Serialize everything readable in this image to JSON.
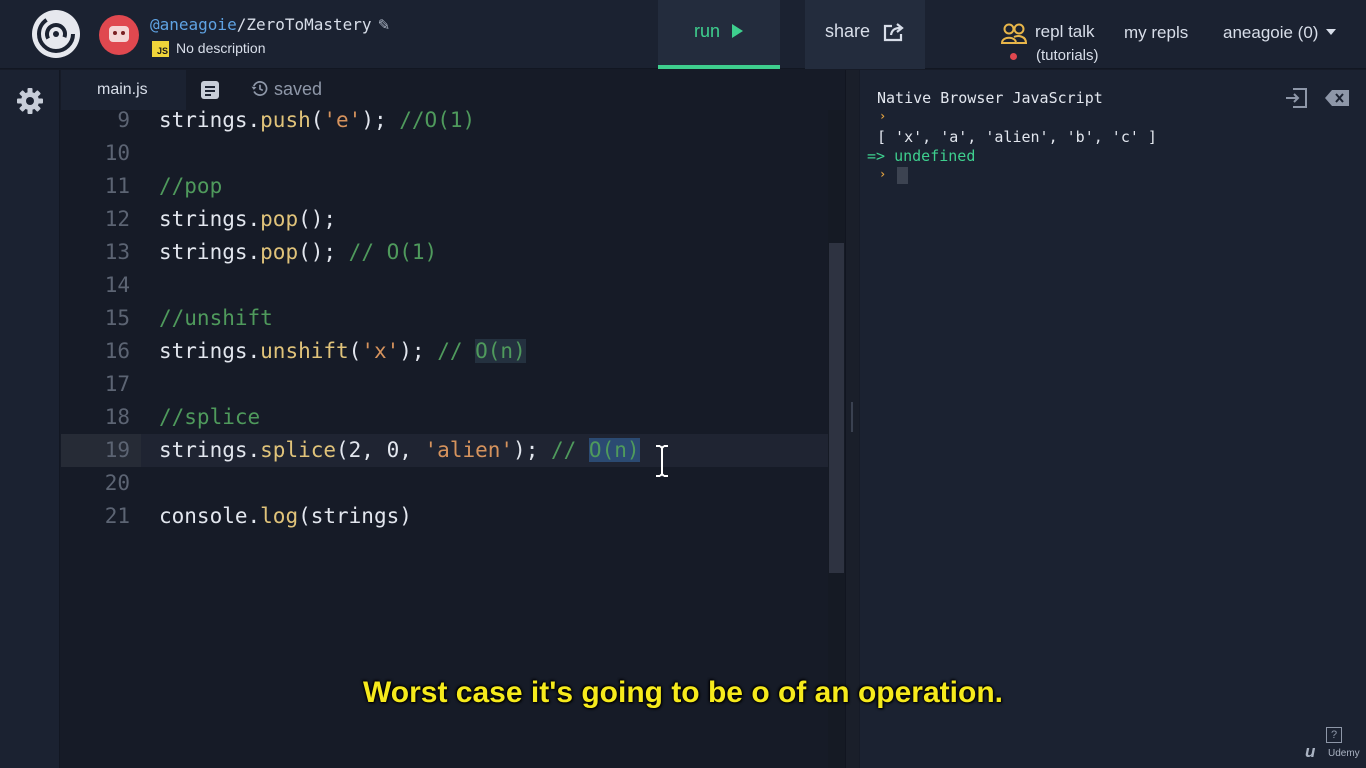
{
  "header": {
    "repl_owner": "@aneagoie",
    "repl_name": "/ZeroToMastery",
    "language_badge": "JS",
    "description": "No description",
    "run_label": "run",
    "share_label": "share",
    "repl_talk_label": "repl talk",
    "repl_talk_sublabel": "(tutorials)",
    "my_repls_label": "my repls",
    "account_label": "aneagoie (0)"
  },
  "editor": {
    "tab_label": "main.js",
    "save_status": "saved",
    "lines": [
      {
        "num": "9",
        "code": "strings.push('e'); //O(1)"
      },
      {
        "num": "10",
        "code": ""
      },
      {
        "num": "11",
        "code": "//pop"
      },
      {
        "num": "12",
        "code": "strings.pop();"
      },
      {
        "num": "13",
        "code": "strings.pop(); // O(1)"
      },
      {
        "num": "14",
        "code": ""
      },
      {
        "num": "15",
        "code": "//unshift"
      },
      {
        "num": "16",
        "code": "strings.unshift('x'); // O(n)"
      },
      {
        "num": "17",
        "code": ""
      },
      {
        "num": "18",
        "code": "//splice"
      },
      {
        "num": "19",
        "code": "strings.splice(2, 0, 'alien'); // O(n)"
      },
      {
        "num": "20",
        "code": ""
      },
      {
        "num": "21",
        "code": "console.log(strings)"
      }
    ],
    "active_line": "19"
  },
  "console": {
    "title": "Native Browser JavaScript",
    "output": "[ 'x', 'a', 'alien', 'b', 'c' ]",
    "result": "=> undefined"
  },
  "overlay": {
    "subtitle": "Worst case it's going to be o of an operation.",
    "watermark": "Udemy",
    "help_glyph": "?"
  },
  "colors": {
    "accent_green": "#3ecf8e",
    "subtitle_yellow": "#f6ea1c",
    "avatar_red": "#e0484f"
  },
  "icons": [
    "replit-logo-icon",
    "robot-avatar-icon",
    "pencil-icon",
    "play-icon",
    "share-icon",
    "people-icon",
    "caret-down-icon",
    "gear-icon",
    "document-icon",
    "history-icon",
    "console-expand-icon",
    "console-clear-icon",
    "text-cursor-icon"
  ]
}
